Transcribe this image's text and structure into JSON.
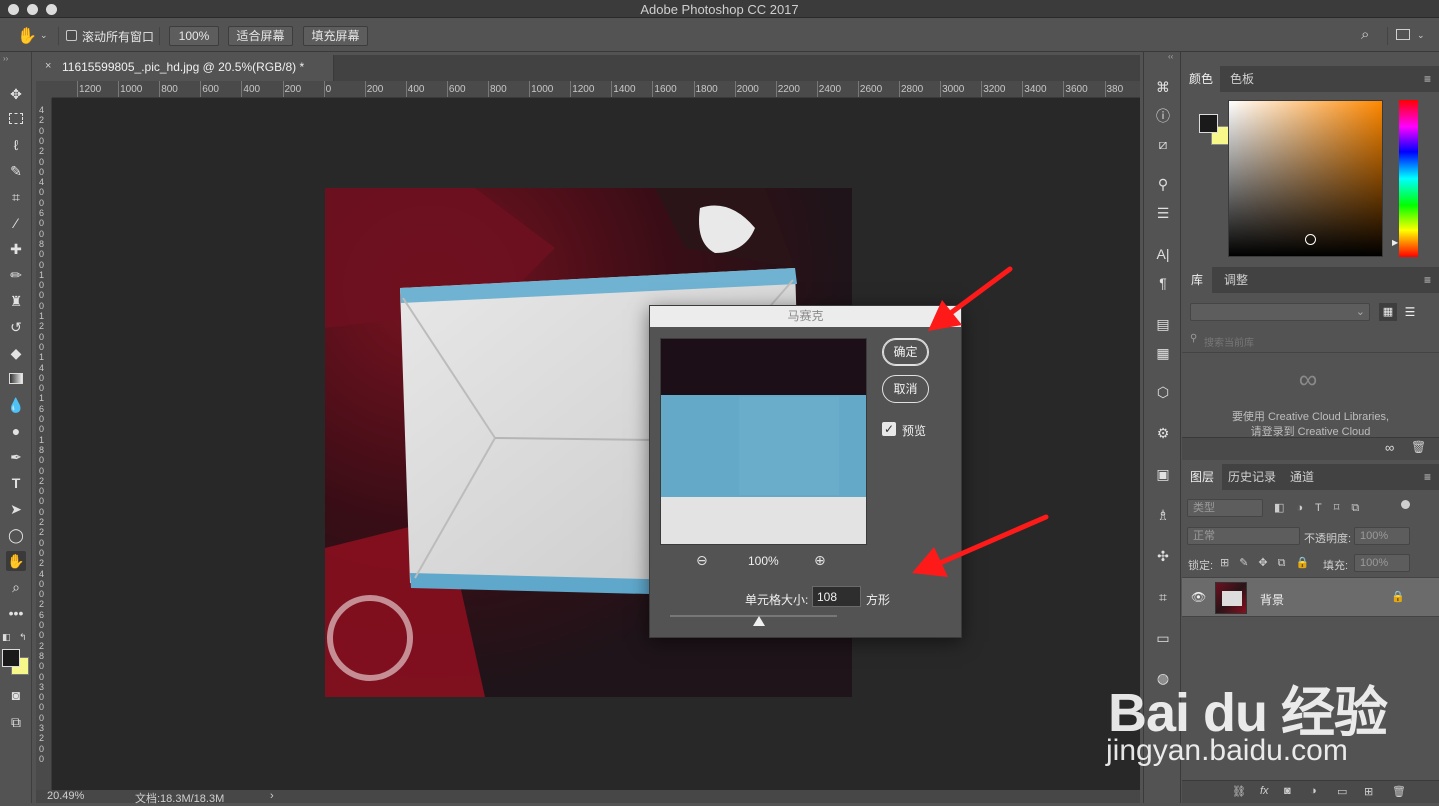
{
  "window": {
    "title": "Adobe Photoshop CC 2017"
  },
  "options_bar": {
    "scroll_all_label": "滚动所有窗口",
    "zoom_100_label": "100%",
    "fit_screen_label": "适合屏幕",
    "fill_screen_label": "填充屏幕"
  },
  "document": {
    "tab_label": "11615599805_.pic_hd.jpg @ 20.5%(RGB/8) *",
    "ruler_ticks": [
      "1200",
      "1000",
      "800",
      "600",
      "400",
      "200",
      "0",
      "200",
      "400",
      "600",
      "800",
      "1000",
      "1200",
      "1400",
      "1600",
      "1800",
      "2000",
      "2200",
      "2400",
      "2600",
      "2800",
      "3000",
      "3200",
      "3400",
      "3600",
      "380"
    ],
    "vruler_ticks": [
      "4",
      "2",
      "0",
      "0",
      "2",
      "0",
      "0",
      "4",
      "0",
      "0",
      "6",
      "0",
      "0",
      "8",
      "0",
      "0",
      "1",
      "0",
      "0",
      "0",
      "1",
      "2",
      "0",
      "0",
      "1",
      "4",
      "0",
      "0",
      "1",
      "6",
      "0",
      "0",
      "1",
      "8",
      "0",
      "0",
      "2",
      "0",
      "0",
      "0",
      "2",
      "2",
      "0",
      "0",
      "2",
      "4",
      "0",
      "0",
      "2",
      "6",
      "0",
      "0",
      "2",
      "8",
      "0",
      "0",
      "3",
      "0",
      "0",
      "0",
      "3",
      "2",
      "0",
      "0"
    ]
  },
  "status_bar": {
    "zoom": "20.49%",
    "doc_info": "文档:18.3M/18.3M",
    "arrow": "›"
  },
  "mosaic_dialog": {
    "title": "马赛克",
    "ok_label": "确定",
    "cancel_label": "取消",
    "preview_label": "预览",
    "preview_checked": true,
    "zoom_level": "100%",
    "cell_size_label": "单元格大小:",
    "cell_size_value": "108",
    "cell_unit": "方形",
    "slider_level": 0.53
  },
  "color_panel": {
    "tabs": [
      "颜色",
      "色板"
    ],
    "foreground": "#1a1a1a",
    "background": "#f7f78a",
    "hue_color": "#ff8800"
  },
  "library_panel": {
    "tabs": [
      "库",
      "调整"
    ],
    "search_placeholder": "搜索当前库",
    "message_line1": "要使用 Creative Cloud Libraries,",
    "message_line2": "请登录到 Creative Cloud"
  },
  "layers_panel": {
    "tabs": [
      "图层",
      "历史记录",
      "通道"
    ],
    "filter_kind": "类型",
    "blend_mode": "正常",
    "opacity_label": "不透明度:",
    "opacity_value": "100%",
    "lock_label": "锁定:",
    "fill_label": "填充:",
    "fill_value": "100%",
    "layers": [
      {
        "name": "背景",
        "visible": true,
        "locked": true
      }
    ],
    "bottom_fx": "fx"
  },
  "colors": {
    "arrow_red": "#ff1a1a",
    "dialog_bg": "#535353",
    "preview_blue": "#65a9c8"
  },
  "watermark": {
    "brand": "Bai du 经验",
    "url": "jingyan.baidu.com"
  }
}
